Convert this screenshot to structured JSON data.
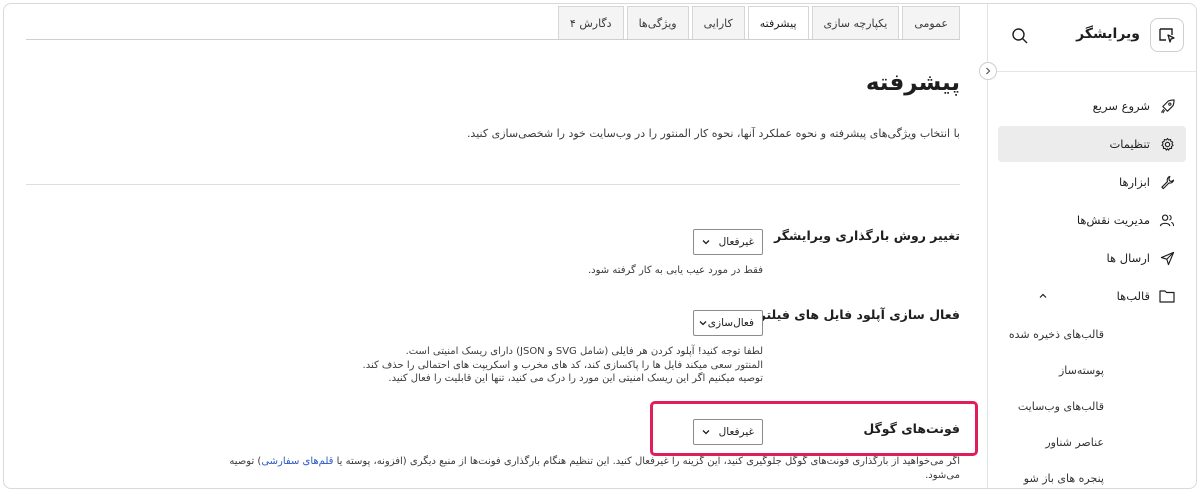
{
  "brand": {
    "name": "ویرایشگر"
  },
  "sidebar": {
    "items": [
      {
        "label": "شروع سریع",
        "icon": "rocket-icon"
      },
      {
        "label": "تنظیمات",
        "icon": "gear-icon",
        "active": true
      },
      {
        "label": "ابزارها",
        "icon": "wrench-icon"
      },
      {
        "label": "مدیریت نقش‌ها",
        "icon": "users-icon"
      },
      {
        "label": "ارسال ها",
        "icon": "send-icon"
      },
      {
        "label": "قالب‌ها",
        "icon": "folder-icon",
        "expanded": true
      }
    ],
    "sub_items": [
      {
        "label": "قالب‌های ذخیره شده"
      },
      {
        "label": "پوسته‌ساز"
      },
      {
        "label": "قالب‌های وب‌سایت"
      },
      {
        "label": "عناصر شناور"
      },
      {
        "label": "پنجره های باز شو"
      }
    ]
  },
  "tabs": [
    {
      "label": "عمومی"
    },
    {
      "label": "یکپارچه سازی"
    },
    {
      "label": "پیشرفته",
      "active": true
    },
    {
      "label": "کارایی"
    },
    {
      "label": "ویژگی‌ها"
    },
    {
      "label": "دگارش ۴"
    }
  ],
  "page": {
    "title": "پیشرفته",
    "description": "با انتخاب ویژگی‌های پیشرفته و نحوه عملکرد آنها، نحوه کار المنتور را در وب‌سایت خود را شخصی‌سازی کنید."
  },
  "settings": {
    "loading_method": {
      "label": "تغییر روش بارگذاری ویرایشگر",
      "value": "غیرفعال",
      "help": "فقط در مورد عیب یابی به کار گرفته شود."
    },
    "unfiltered_upload": {
      "label": "فعال سازی آپلود فایل های فیلتر نشده",
      "value": "فعال‌سازی",
      "help_lines": [
        "لطفا توجه کنید! آپلود کردن هر فایلی (شامل SVG و JSON) دارای ریسک امنیتی است.",
        "المنتور سعی میکند فایل ها را پاکسازی کند، کد های مخرب و اسکریپت های احتمالی را حذف کند.",
        "توصیه میکنیم اگر این ریسک امنیتی این مورد را درک می کنید، تنها این قابلیت را فعال کنید."
      ]
    },
    "google_fonts": {
      "label": "فونت‌های گوگل",
      "value": "غیرفعال",
      "help_before": "اگر می‌خواهید از بارگذاری فونت‌های گوگل جلوگیری کنید، این گزینه را غیرفعال کنید. این تنظیم هنگام بارگذاری فونت‌ها از منبع دیگری (افزونه، پوسته یا",
      "help_link": "قلم‌های سفارشی",
      "help_after": ") توصیه",
      "help_line2": "می‌شود."
    }
  },
  "colors": {
    "highlight": "#e01e5a",
    "link": "#2b59c3",
    "active_nav": "#ececec"
  }
}
